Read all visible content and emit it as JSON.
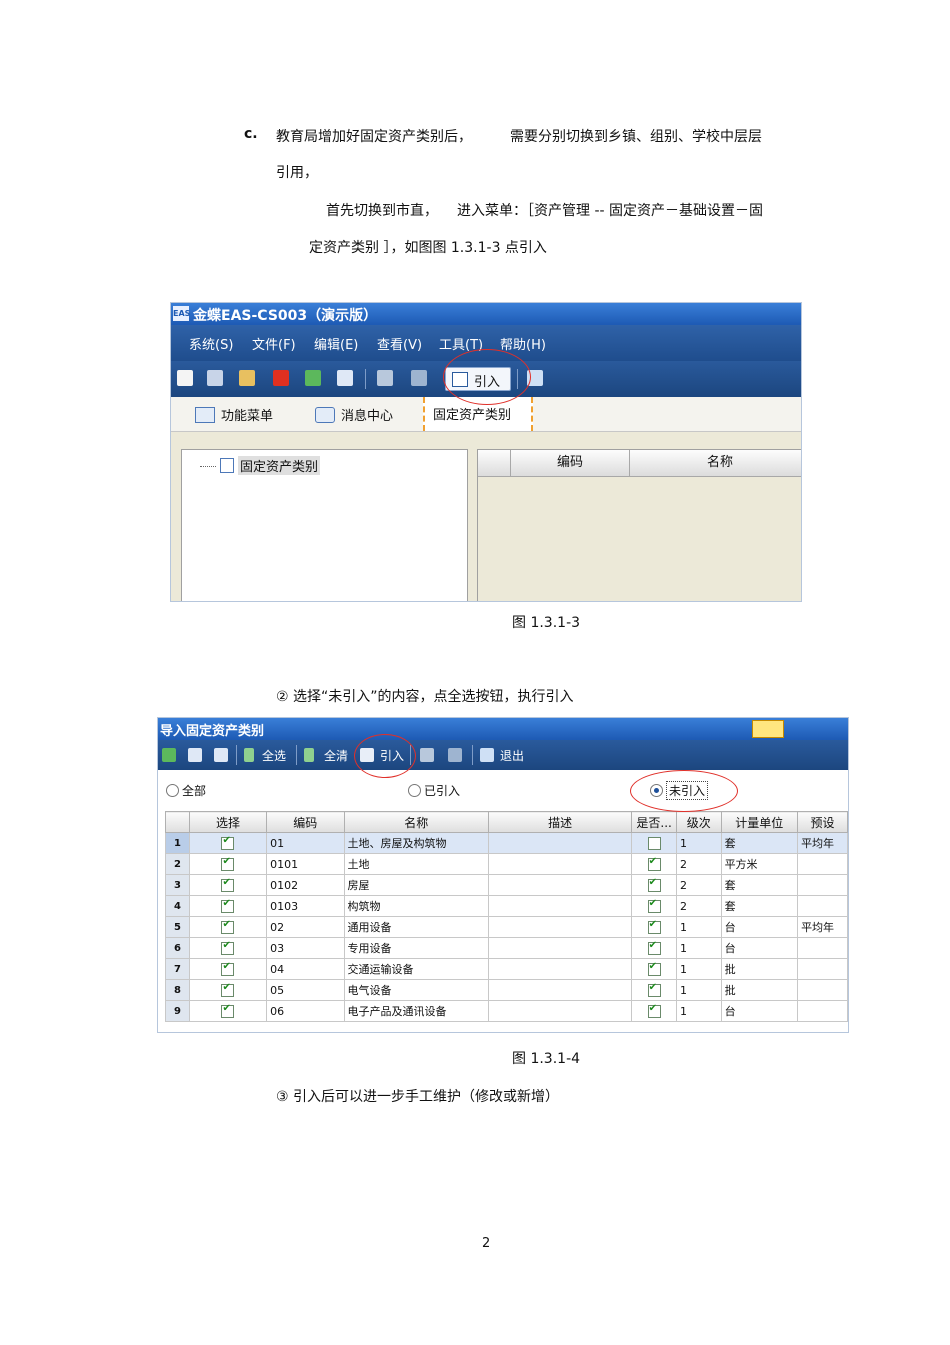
{
  "doc": {
    "item_c_marker": "c.",
    "para1_a": "教育局增加好固定资产类别后，",
    "para1_b": "需要分别切换到乡镇、组别、学校中层层",
    "para1_c": "引用，",
    "para2_a": "首先切换到市直，",
    "para2_b": "进入菜单：［资产管理 -- 固定资产－基础设置－固",
    "para2_c": "定资产类别 ］，如图图 1.3.1-3 点引入",
    "caption1": "图 1.3.1-3",
    "step2": "② 选择“未引入”的内容，点全选按钮，执行引入",
    "caption2": "图 1.3.1-4",
    "step3": "③ 引入后可以进一步手工维护（修改或新增）",
    "page_number": "2"
  },
  "screen1": {
    "app_title": "金蝶EAS-CS003（演示版）",
    "logo_text": "EAS",
    "menus": [
      "系统(S)",
      "文件(F)",
      "编辑(E)",
      "查看(V)",
      "工具(T)",
      "帮助(H)"
    ],
    "import_button": "引入",
    "tabs": [
      "功能菜单",
      "消息中心",
      "固定资产类别"
    ],
    "tree_root": "固定资产类别",
    "grid_headers": [
      "编码",
      "名称"
    ]
  },
  "screen2": {
    "title": "导入固定资产类别",
    "toolbar": {
      "select_all": "全选",
      "clear_all": "全清",
      "import": "引入",
      "exit": "退出"
    },
    "filters": {
      "all": "全部",
      "imported": "已引入",
      "not_imported": "未引入",
      "selected": "not_imported"
    },
    "columns": [
      "选择",
      "编码",
      "名称",
      "描述",
      "是否...",
      "级次",
      "计量单位",
      "预设"
    ],
    "rows": [
      {
        "n": "1",
        "sel": true,
        "code": "01",
        "name": "土地、房屋及构筑物",
        "desc": "",
        "flag": false,
        "level": "1",
        "unit": "套",
        "preset": "平均年"
      },
      {
        "n": "2",
        "sel": true,
        "code": "0101",
        "name": "土地",
        "desc": "",
        "flag": true,
        "level": "2",
        "unit": "平方米",
        "preset": ""
      },
      {
        "n": "3",
        "sel": true,
        "code": "0102",
        "name": "房屋",
        "desc": "",
        "flag": true,
        "level": "2",
        "unit": "套",
        "preset": ""
      },
      {
        "n": "4",
        "sel": true,
        "code": "0103",
        "name": "构筑物",
        "desc": "",
        "flag": true,
        "level": "2",
        "unit": "套",
        "preset": ""
      },
      {
        "n": "5",
        "sel": true,
        "code": "02",
        "name": "通用设备",
        "desc": "",
        "flag": true,
        "level": "1",
        "unit": "台",
        "preset": "平均年"
      },
      {
        "n": "6",
        "sel": true,
        "code": "03",
        "name": "专用设备",
        "desc": "",
        "flag": true,
        "level": "1",
        "unit": "台",
        "preset": ""
      },
      {
        "n": "7",
        "sel": true,
        "code": "04",
        "name": "交通运输设备",
        "desc": "",
        "flag": true,
        "level": "1",
        "unit": "批",
        "preset": ""
      },
      {
        "n": "8",
        "sel": true,
        "code": "05",
        "name": "电气设备",
        "desc": "",
        "flag": true,
        "level": "1",
        "unit": "批",
        "preset": ""
      },
      {
        "n": "9",
        "sel": true,
        "code": "06",
        "name": "电子产品及通讯设备",
        "desc": "",
        "flag": true,
        "level": "1",
        "unit": "台",
        "preset": ""
      }
    ]
  },
  "colors": {
    "title_blue": "#1d5ab4",
    "toolbar_blue": "#1f4d8d",
    "annotation_red": "#e0302a",
    "check_green": "#1c8a1c"
  }
}
